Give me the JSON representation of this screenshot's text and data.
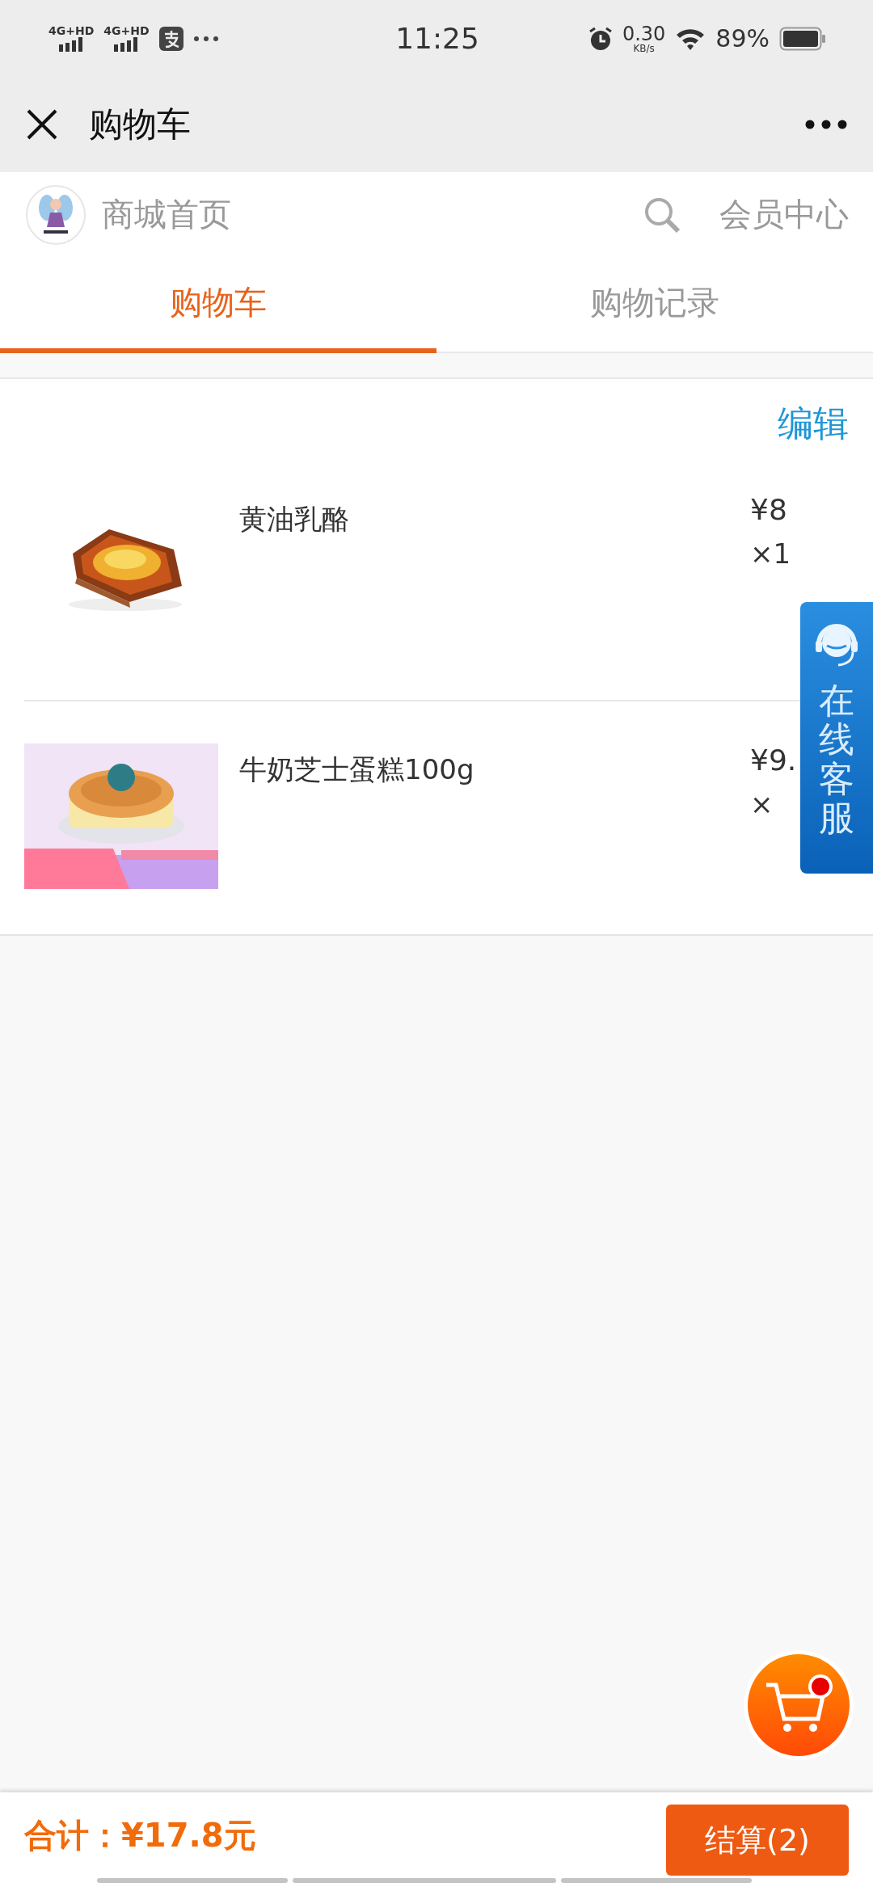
{
  "status_bar": {
    "network_labels": [
      "4G+HD",
      "4G+HD"
    ],
    "time": "11:25",
    "speed": "0.30",
    "speed_unit": "KB/s",
    "battery": "89%"
  },
  "nav_bar": {
    "title": "购物车"
  },
  "shop_header": {
    "home_link": "商城首页",
    "member_link": "会员中心"
  },
  "tabs": [
    {
      "label": "购物车",
      "selected": true
    },
    {
      "label": "购物记录",
      "selected": false
    }
  ],
  "cart": {
    "edit": "编辑",
    "items": [
      {
        "name": "黄油乳酪",
        "price": "¥8",
        "quantity": "×1"
      },
      {
        "name": "牛奶芝士蛋糕100g",
        "price": "¥9.",
        "quantity": "×"
      }
    ]
  },
  "service_tab": {
    "label": "在线客服"
  },
  "cart_button": {
    "badge": true
  },
  "footer": {
    "total": "合计：¥17.8元",
    "checkout": "结算(2)"
  }
}
